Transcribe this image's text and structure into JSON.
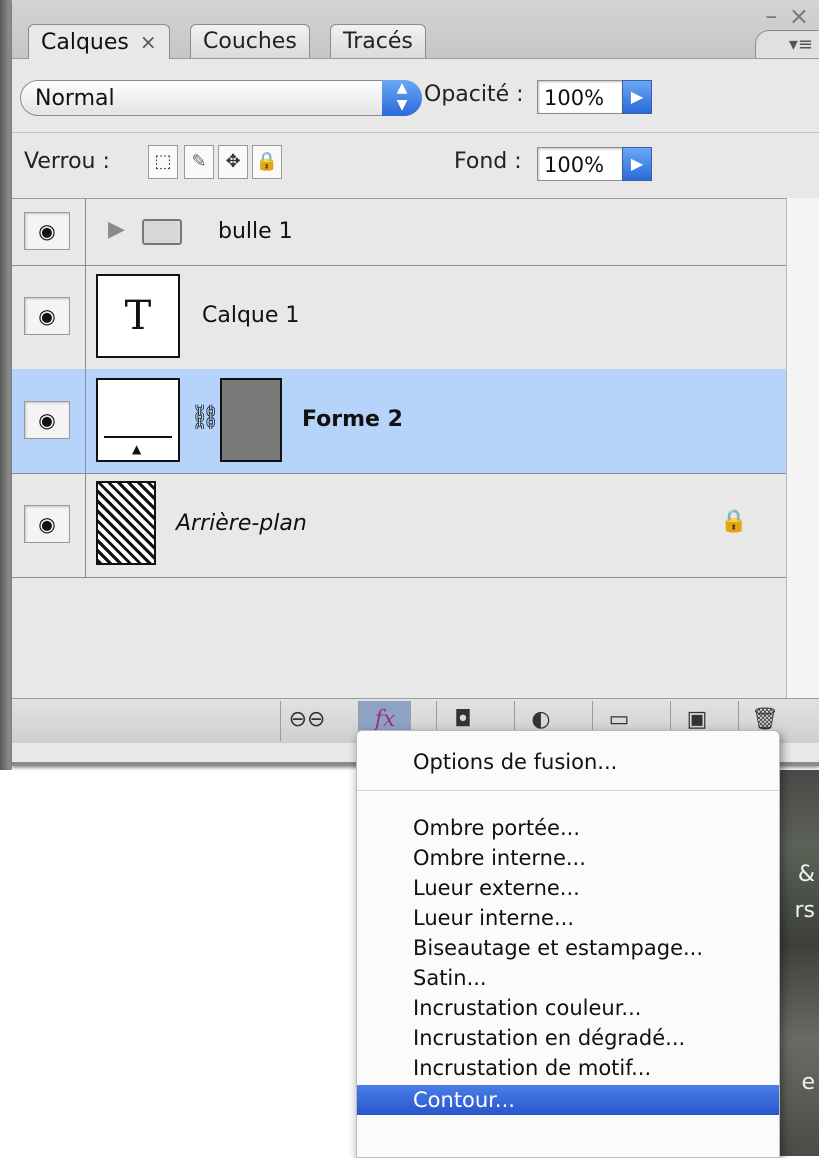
{
  "tabs": [
    {
      "label": "Calques",
      "close": "×",
      "active": true
    },
    {
      "label": "Couches",
      "active": false
    },
    {
      "label": "Tracés",
      "active": false
    }
  ],
  "window_controls": "– ×",
  "blend": {
    "mode": "Normal",
    "opacity_label": "Opacité :",
    "opacity_value": "100%"
  },
  "lock": {
    "label": "Verrou :",
    "fill_label": "Fond :",
    "fill_value": "100%"
  },
  "layers": [
    {
      "name": "bulle 1",
      "type": "group",
      "selected": false
    },
    {
      "name": "Calque 1",
      "type": "text",
      "thumb_text": "T",
      "selected": false
    },
    {
      "name": "Forme 2",
      "type": "shape",
      "selected": true
    },
    {
      "name": "Arrière-plan",
      "type": "background",
      "locked": true,
      "selected": false
    }
  ],
  "bottom_buttons": [
    "link-icon",
    "fx-icon",
    "mask-icon",
    "adjustment-icon",
    "folder-icon",
    "new-layer-icon",
    "trash-icon"
  ],
  "bottom_fx_label": "fx",
  "menu": {
    "header_item": "Options de fusion...",
    "items": [
      "Ombre portée...",
      "Ombre interne...",
      "Lueur externe...",
      "Lueur interne...",
      "Biseautage et estampage...",
      "Satin...",
      "Incrustation couleur...",
      "Incrustation en dégradé...",
      "Incrustation de motif...",
      "Contour..."
    ],
    "highlighted": "Contour..."
  },
  "background_fragments": [
    "&",
    "rs",
    "e"
  ]
}
